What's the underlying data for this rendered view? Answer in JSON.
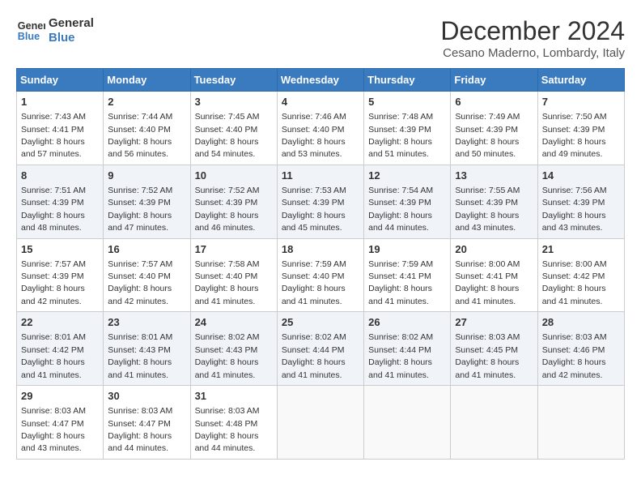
{
  "header": {
    "logo_line1": "General",
    "logo_line2": "Blue",
    "title": "December 2024",
    "subtitle": "Cesano Maderno, Lombardy, Italy"
  },
  "calendar": {
    "headers": [
      "Sunday",
      "Monday",
      "Tuesday",
      "Wednesday",
      "Thursday",
      "Friday",
      "Saturday"
    ],
    "weeks": [
      [
        null,
        {
          "day": 2,
          "sunrise": "7:44 AM",
          "sunset": "4:40 PM",
          "daylight": "8 hours and 56 minutes."
        },
        {
          "day": 3,
          "sunrise": "7:45 AM",
          "sunset": "4:40 PM",
          "daylight": "8 hours and 54 minutes."
        },
        {
          "day": 4,
          "sunrise": "7:46 AM",
          "sunset": "4:40 PM",
          "daylight": "8 hours and 53 minutes."
        },
        {
          "day": 5,
          "sunrise": "7:48 AM",
          "sunset": "4:39 PM",
          "daylight": "8 hours and 51 minutes."
        },
        {
          "day": 6,
          "sunrise": "7:49 AM",
          "sunset": "4:39 PM",
          "daylight": "8 hours and 50 minutes."
        },
        {
          "day": 7,
          "sunrise": "7:50 AM",
          "sunset": "4:39 PM",
          "daylight": "8 hours and 49 minutes."
        }
      ],
      [
        {
          "day": 1,
          "sunrise": "7:43 AM",
          "sunset": "4:41 PM",
          "daylight": "8 hours and 57 minutes."
        },
        null,
        null,
        null,
        null,
        null,
        null
      ],
      [
        {
          "day": 8,
          "sunrise": "7:51 AM",
          "sunset": "4:39 PM",
          "daylight": "8 hours and 48 minutes."
        },
        {
          "day": 9,
          "sunrise": "7:52 AM",
          "sunset": "4:39 PM",
          "daylight": "8 hours and 47 minutes."
        },
        {
          "day": 10,
          "sunrise": "7:52 AM",
          "sunset": "4:39 PM",
          "daylight": "8 hours and 46 minutes."
        },
        {
          "day": 11,
          "sunrise": "7:53 AM",
          "sunset": "4:39 PM",
          "daylight": "8 hours and 45 minutes."
        },
        {
          "day": 12,
          "sunrise": "7:54 AM",
          "sunset": "4:39 PM",
          "daylight": "8 hours and 44 minutes."
        },
        {
          "day": 13,
          "sunrise": "7:55 AM",
          "sunset": "4:39 PM",
          "daylight": "8 hours and 43 minutes."
        },
        {
          "day": 14,
          "sunrise": "7:56 AM",
          "sunset": "4:39 PM",
          "daylight": "8 hours and 43 minutes."
        }
      ],
      [
        {
          "day": 15,
          "sunrise": "7:57 AM",
          "sunset": "4:39 PM",
          "daylight": "8 hours and 42 minutes."
        },
        {
          "day": 16,
          "sunrise": "7:57 AM",
          "sunset": "4:40 PM",
          "daylight": "8 hours and 42 minutes."
        },
        {
          "day": 17,
          "sunrise": "7:58 AM",
          "sunset": "4:40 PM",
          "daylight": "8 hours and 41 minutes."
        },
        {
          "day": 18,
          "sunrise": "7:59 AM",
          "sunset": "4:40 PM",
          "daylight": "8 hours and 41 minutes."
        },
        {
          "day": 19,
          "sunrise": "7:59 AM",
          "sunset": "4:41 PM",
          "daylight": "8 hours and 41 minutes."
        },
        {
          "day": 20,
          "sunrise": "8:00 AM",
          "sunset": "4:41 PM",
          "daylight": "8 hours and 41 minutes."
        },
        {
          "day": 21,
          "sunrise": "8:00 AM",
          "sunset": "4:42 PM",
          "daylight": "8 hours and 41 minutes."
        }
      ],
      [
        {
          "day": 22,
          "sunrise": "8:01 AM",
          "sunset": "4:42 PM",
          "daylight": "8 hours and 41 minutes."
        },
        {
          "day": 23,
          "sunrise": "8:01 AM",
          "sunset": "4:43 PM",
          "daylight": "8 hours and 41 minutes."
        },
        {
          "day": 24,
          "sunrise": "8:02 AM",
          "sunset": "4:43 PM",
          "daylight": "8 hours and 41 minutes."
        },
        {
          "day": 25,
          "sunrise": "8:02 AM",
          "sunset": "4:44 PM",
          "daylight": "8 hours and 41 minutes."
        },
        {
          "day": 26,
          "sunrise": "8:02 AM",
          "sunset": "4:44 PM",
          "daylight": "8 hours and 41 minutes."
        },
        {
          "day": 27,
          "sunrise": "8:03 AM",
          "sunset": "4:45 PM",
          "daylight": "8 hours and 41 minutes."
        },
        {
          "day": 28,
          "sunrise": "8:03 AM",
          "sunset": "4:46 PM",
          "daylight": "8 hours and 42 minutes."
        }
      ],
      [
        {
          "day": 29,
          "sunrise": "8:03 AM",
          "sunset": "4:47 PM",
          "daylight": "8 hours and 43 minutes."
        },
        {
          "day": 30,
          "sunrise": "8:03 AM",
          "sunset": "4:47 PM",
          "daylight": "8 hours and 44 minutes."
        },
        {
          "day": 31,
          "sunrise": "8:03 AM",
          "sunset": "4:48 PM",
          "daylight": "8 hours and 44 minutes."
        },
        null,
        null,
        null,
        null
      ]
    ]
  }
}
